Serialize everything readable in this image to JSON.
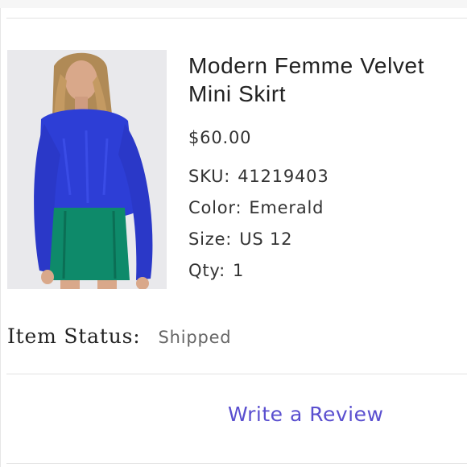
{
  "product": {
    "title": "Modern Femme Velvet Mini Skirt",
    "price": "$60.00",
    "sku_label": "SKU:",
    "sku_value": "41219403",
    "color_label": "Color:",
    "color_value": "Emerald",
    "size_label": "Size:",
    "size_value": "US 12",
    "qty_label": "Qty:",
    "qty_value": "1",
    "image": {
      "sweater_color": "#2d3ed6",
      "skirt_color": "#0e8a6a",
      "background_color": "#e9e9ec"
    }
  },
  "status": {
    "label": "Item Status:",
    "value": "Shipped"
  },
  "actions": {
    "review_label": "Write a Review",
    "link_color": "#5a4fcf"
  }
}
